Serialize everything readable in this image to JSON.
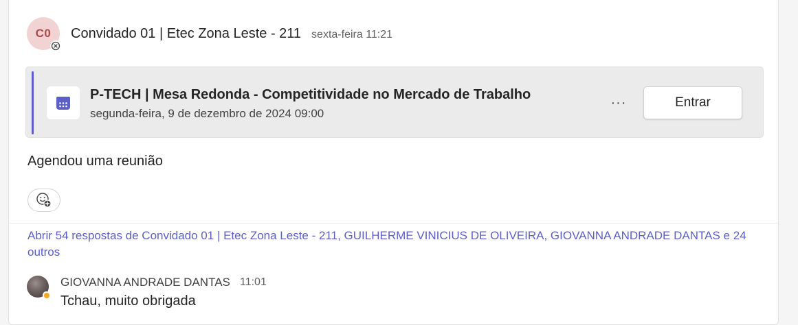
{
  "message": {
    "avatar_initials": "C0",
    "sender": "Convidado 01 | Etec Zona Leste - 211",
    "time": "sexta-feira 11:21",
    "text": "Agendou uma reunião"
  },
  "meeting": {
    "title": "P-TECH | Mesa Redonda - Competitividade no Mercado de Trabalho",
    "date": "segunda-feira, 9 de dezembro de 2024 09:00",
    "more_label": "···",
    "join_label": "Entrar",
    "icon": "calendar-icon"
  },
  "replies": {
    "link_text": "Abrir 54 respostas de Convidado 01 | Etec Zona Leste - 211, GUILHERME VINICIUS DE OLIVEIRA, GIOVANNA ANDRADE DANTAS e 24 outros"
  },
  "reply": {
    "sender": "GIOVANNA ANDRADE DANTAS",
    "time": "11:01",
    "text": "Tchau, muito obrigada"
  },
  "colors": {
    "accent": "#5b5fc7",
    "avatar_bg": "#f2d3d3",
    "avatar_text": "#b04848",
    "away_status": "#f5a623"
  }
}
